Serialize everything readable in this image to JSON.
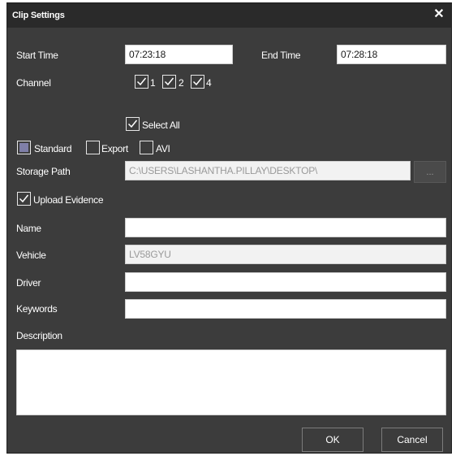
{
  "dialog": {
    "title": "Clip Settings",
    "close_glyph": "✕"
  },
  "time": {
    "start_label": "Start Time",
    "start_value": "07:23:18",
    "end_label": "End Time",
    "end_value": "07:28:18"
  },
  "channel": {
    "label": "Channel",
    "items": [
      {
        "label": "1",
        "checked": true
      },
      {
        "label": "2",
        "checked": true
      },
      {
        "label": "4",
        "checked": true
      }
    ],
    "select_all_label": "Select All",
    "select_all_checked": true
  },
  "format": {
    "options": [
      {
        "label": "Standard",
        "state": "indeterminate"
      },
      {
        "label": "Export",
        "state": "unchecked"
      },
      {
        "label": "AVI",
        "state": "unchecked"
      }
    ]
  },
  "storage": {
    "label": "Storage Path",
    "value": "C:\\USERS\\LASHANTHA.PILLAY\\DESKTOP\\",
    "browse_label": "..."
  },
  "evidence": {
    "label": "Upload Evidence",
    "checked": true
  },
  "form": {
    "name_label": "Name",
    "name_value": "",
    "vehicle_label": "Vehicle",
    "vehicle_value": "LV58GYU",
    "driver_label": "Driver",
    "driver_value": "",
    "keywords_label": "Keywords",
    "keywords_value": "",
    "description_label": "Description",
    "description_value": ""
  },
  "buttons": {
    "ok": "OK",
    "cancel": "Cancel"
  },
  "colors": {
    "dialog_bg": "#3c3c3c",
    "titlebar_bg": "#2a2a2a",
    "indeterminate": "#7f7fa8"
  }
}
